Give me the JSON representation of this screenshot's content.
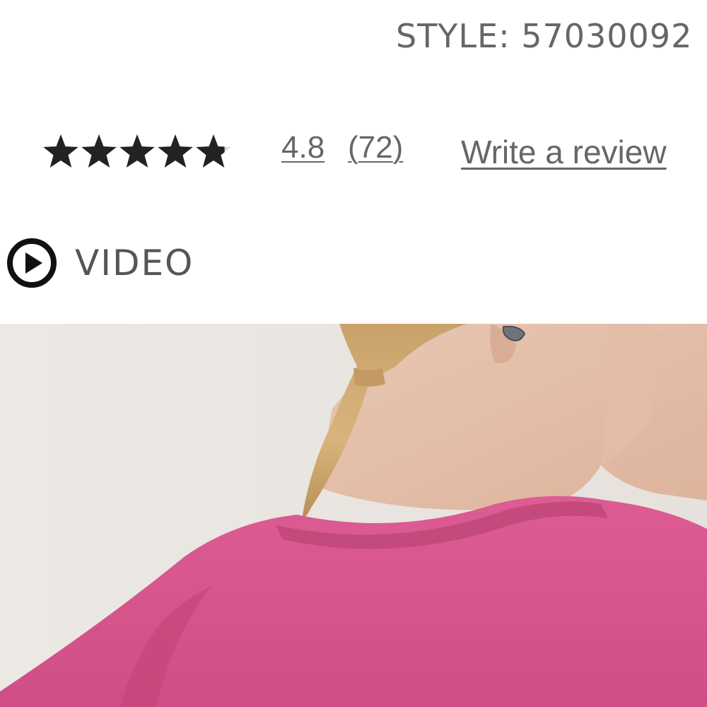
{
  "product": {
    "style_text": "STYLE: 57030092"
  },
  "rating": {
    "stars_value": 4.8,
    "stars_max": 5,
    "value_text": "4.8",
    "count_text": "(72)",
    "write_review_label": "Write a review",
    "star_color": "#222222"
  },
  "video": {
    "label": "VIDEO",
    "icon": "play-circle-icon"
  },
  "image": {
    "subject": "product-photo",
    "sweater_color": "#d9558d",
    "background_color": "#e9e5e1"
  }
}
